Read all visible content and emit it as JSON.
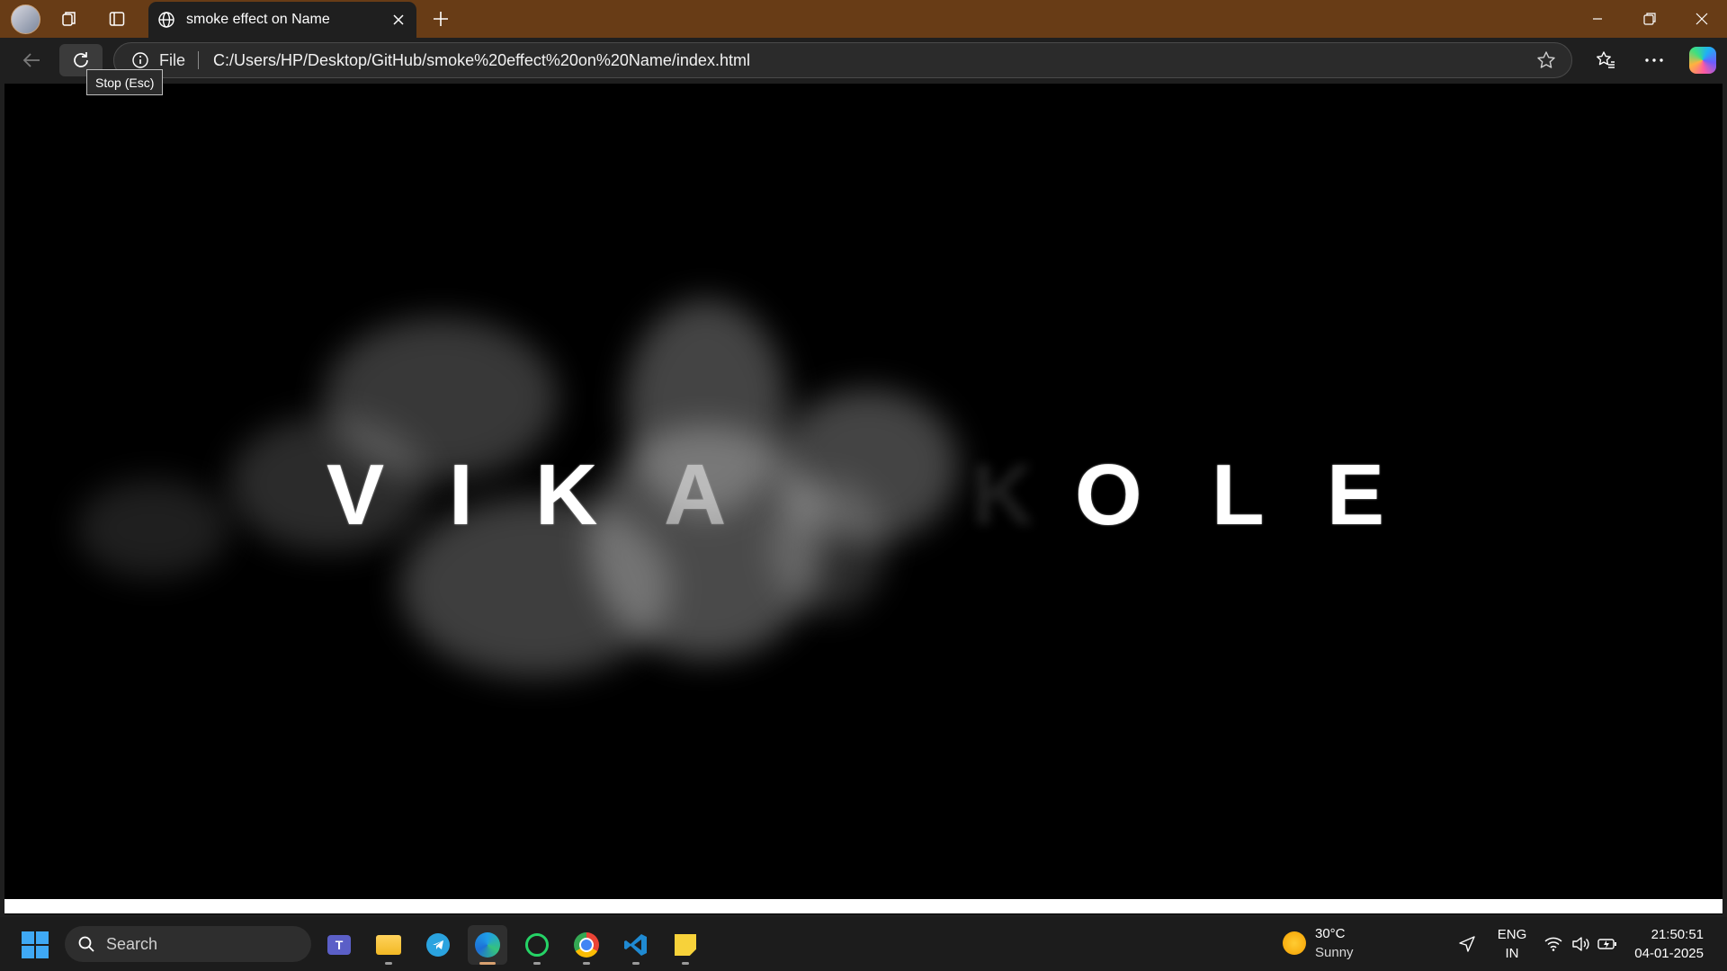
{
  "browser": {
    "tab_title": "smoke effect on Name",
    "address_scheme": "File",
    "url": "C:/Users/HP/Desktop/GitHub/smoke%20effect%20on%20Name/index.html",
    "tooltip": "Stop (Esc)",
    "icons": [
      "profile-avatar",
      "workspaces-icon",
      "vertical-tabs-icon",
      "globe-icon",
      "close-icon",
      "plus-icon",
      "minimize-icon",
      "restore-icon",
      "window-close-icon",
      "back-arrow-icon",
      "reload-icon",
      "info-icon",
      "star-icon",
      "favorites-icon",
      "more-icon",
      "copilot-icon"
    ]
  },
  "page": {
    "background": "#000000",
    "letters": [
      "V",
      "I",
      "K",
      "A",
      "K",
      "O",
      "L",
      "E"
    ]
  },
  "taskbar": {
    "search_label": "Search",
    "apps": [
      "teams-icon",
      "file-explorer-icon",
      "telegram-icon",
      "edge-icon",
      "whatsapp-icon",
      "chrome-icon",
      "vscode-icon",
      "sticky-notes-icon"
    ],
    "weather_temp": "30°C",
    "weather_condition": "Sunny",
    "language_line1": "ENG",
    "language_line2": "IN",
    "time": "21:50:51",
    "date": "04-01-2025"
  }
}
